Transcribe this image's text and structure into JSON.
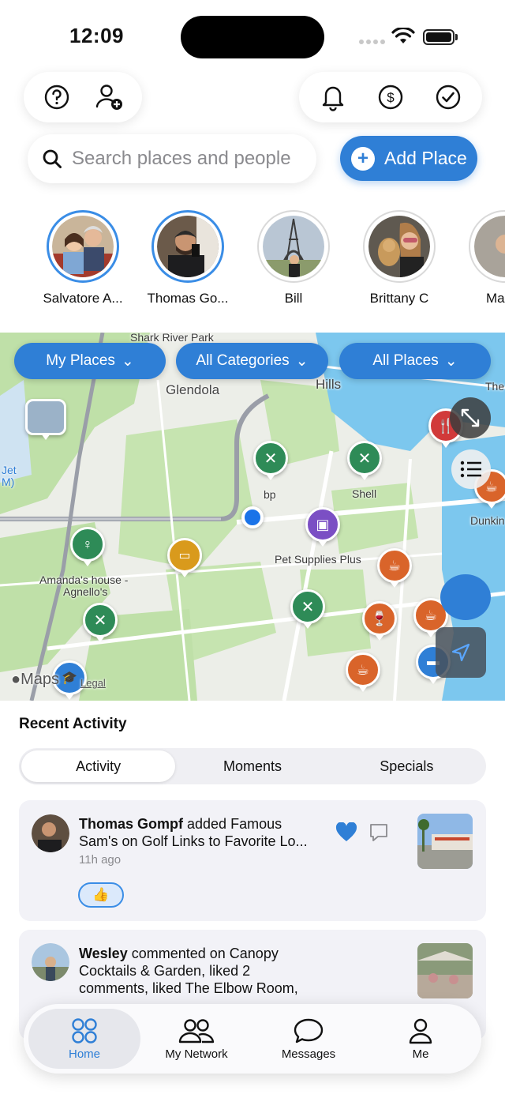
{
  "status_bar": {
    "time": "12:09"
  },
  "search": {
    "placeholder": "Search places and people"
  },
  "add_place": {
    "label": "Add Place"
  },
  "stories": [
    {
      "name": "Salvatore A...",
      "active": true
    },
    {
      "name": "Thomas Go...",
      "active": true
    },
    {
      "name": "Bill",
      "active": false
    },
    {
      "name": "Brittany C",
      "active": false
    },
    {
      "name": "Mar",
      "active": false
    }
  ],
  "map": {
    "filters": {
      "my_places": "My Places",
      "all_categories": "All Categories",
      "all_places": "All Places"
    },
    "labels": {
      "shark_river_park": "Shark River Park",
      "glendola": "Glendola",
      "hills": "Hills",
      "the": "The",
      "jet": "Jet",
      "m": "M)",
      "bp": "bp",
      "shell": "Shell",
      "dunkin": "Dunkin",
      "pet_supplies_plus": "Pet Supplies Plus",
      "amandas_house": "Amanda's house -",
      "agnellos": "Agnello's",
      "maps": "Maps",
      "legal": "Legal"
    }
  },
  "recent_activity": {
    "title": "Recent Activity",
    "tabs": [
      "Activity",
      "Moments",
      "Specials"
    ],
    "items": [
      {
        "user": "Thomas Gompf",
        "text_line1": " added Famous",
        "text_line2": "Sam's on Golf Links to Favorite Lo...",
        "time": "11h ago",
        "reaction": "👍",
        "liked": true
      },
      {
        "user": "Wesley",
        "text_line1": " commented on Canopy",
        "text_line2": "Cocktails & Garden, liked 2",
        "text_line3": "comments, liked The Elbow Room,"
      }
    ]
  },
  "tabbar": {
    "home": "Home",
    "my_network": "My Network",
    "messages": "Messages",
    "me": "Me"
  },
  "colors": {
    "accent": "#2f7fd6",
    "pin_green": "#2e8b57",
    "pin_orange": "#d9642a",
    "pin_purple": "#7b4fc4"
  }
}
